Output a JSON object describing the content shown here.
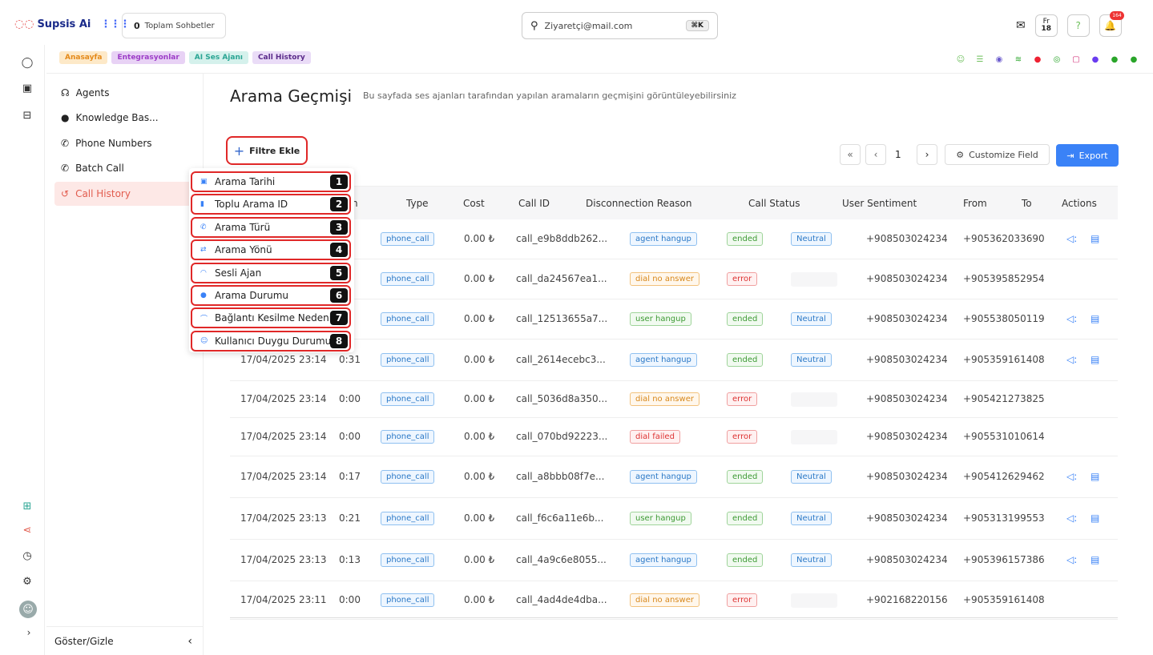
{
  "header": {
    "brand": "Supsis Ai",
    "chat_count": "0",
    "chat_label": "Toplam Sohbetler",
    "search_value": "Ziyaretçi@mail.com",
    "search_shortcut": "⌘K",
    "font_btn_top": "Fr",
    "font_btn_size": "18",
    "help": "?",
    "notif_count": "164"
  },
  "tabs": [
    {
      "label": "Anasayfa",
      "bg": "#fde9c8",
      "color": "#e48a1a"
    },
    {
      "label": "Entegrasyonlar",
      "bg": "#e8d2f5",
      "color": "#9c3cc7"
    },
    {
      "label": "AI Ses Ajanı",
      "bg": "#d5f1ec",
      "color": "#2aa593"
    },
    {
      "label": "Call History",
      "bg": "#eadcf7",
      "color": "#5a2a8a"
    }
  ],
  "sidebar": {
    "items": [
      {
        "label": "Agents"
      },
      {
        "label": "Knowledge Bas..."
      },
      {
        "label": "Phone Numbers"
      },
      {
        "label": "Batch Call"
      },
      {
        "label": "Call History"
      }
    ],
    "footer": "Göster/Gizle"
  },
  "page": {
    "title": "Arama Geçmişi",
    "subtitle": "Bu sayfada ses ajanları tarafından yapılan aramaların geçmişini görüntüleyebilirsiniz",
    "filter_btn": "Filtre Ekle",
    "page_num": "1",
    "customize": "Customize Field",
    "export": "Export"
  },
  "table": {
    "headers": [
      "n",
      "Type",
      "Cost",
      "Call ID",
      "Disconnection Reason",
      "Call Status",
      "User Sentiment",
      "From",
      "To",
      "Actions"
    ],
    "rows": [
      {
        "date": "",
        "dur": "19",
        "type": "phone_call",
        "cost": "0.00 ₺",
        "id": "call_e9b8ddb262...",
        "reason": "agent hangup",
        "rclass": "agent",
        "status": "ended",
        "sentiment": "Neutral",
        "from": "+908503024234",
        "to": "+905362033690",
        "actions": true
      },
      {
        "date": "",
        "dur": "00",
        "type": "phone_call",
        "cost": "0.00 ₺",
        "id": "call_da24567ea1...",
        "reason": "dial no answer",
        "rclass": "dna",
        "status": "error",
        "sentiment": "",
        "from": "+908503024234",
        "to": "+905395852954",
        "actions": false
      },
      {
        "date": "",
        "dur": "9",
        "type": "phone_call",
        "cost": "0.00 ₺",
        "id": "call_12513655a7...",
        "reason": "user hangup",
        "rclass": "user",
        "status": "ended",
        "sentiment": "Neutral",
        "from": "+908503024234",
        "to": "+905538050119",
        "actions": true
      },
      {
        "date": "17/04/2025 23:14",
        "dur": "0:31",
        "type": "phone_call",
        "cost": "0.00 ₺",
        "id": "call_2614ecebc3...",
        "reason": "agent hangup",
        "rclass": "agent",
        "status": "ended",
        "sentiment": "Neutral",
        "from": "+908503024234",
        "to": "+905359161408",
        "actions": true
      },
      {
        "date": "17/04/2025 23:14",
        "dur": "0:00",
        "type": "phone_call",
        "cost": "0.00 ₺",
        "id": "call_5036d8a350...",
        "reason": "dial no answer",
        "rclass": "dna",
        "status": "error",
        "sentiment": "",
        "from": "+908503024234",
        "to": "+905421273825",
        "actions": false
      },
      {
        "date": "17/04/2025 23:14",
        "dur": "0:00",
        "type": "phone_call",
        "cost": "0.00 ₺",
        "id": "call_070bd92223...",
        "reason": "dial failed",
        "rclass": "df",
        "status": "error",
        "sentiment": "",
        "from": "+908503024234",
        "to": "+905531010614",
        "actions": false
      },
      {
        "date": "17/04/2025 23:14",
        "dur": "0:17",
        "type": "phone_call",
        "cost": "0.00 ₺",
        "id": "call_a8bbb08f7e...",
        "reason": "agent hangup",
        "rclass": "agent",
        "status": "ended",
        "sentiment": "Neutral",
        "from": "+908503024234",
        "to": "+905412629462",
        "actions": true
      },
      {
        "date": "17/04/2025 23:13",
        "dur": "0:21",
        "type": "phone_call",
        "cost": "0.00 ₺",
        "id": "call_f6c6a11e6b...",
        "reason": "user hangup",
        "rclass": "user",
        "status": "ended",
        "sentiment": "Neutral",
        "from": "+908503024234",
        "to": "+905313199553",
        "actions": true
      },
      {
        "date": "17/04/2025 23:13",
        "dur": "0:13",
        "type": "phone_call",
        "cost": "0.00 ₺",
        "id": "call_4a9c6e8055...",
        "reason": "agent hangup",
        "rclass": "agent",
        "status": "ended",
        "sentiment": "Neutral",
        "from": "+908503024234",
        "to": "+905396157386",
        "actions": true
      },
      {
        "date": "17/04/2025 23:11",
        "dur": "0:00",
        "type": "phone_call",
        "cost": "0.00 ₺",
        "id": "call_4ad4de4dba...",
        "reason": "dial no answer",
        "rclass": "dna",
        "status": "error",
        "sentiment": "",
        "from": "+902168220156",
        "to": "+905359161408",
        "actions": false
      }
    ]
  },
  "dropdown": [
    {
      "label": "Arama Tarihi",
      "num": "1",
      "icon": "calendar-icon"
    },
    {
      "label": "Toplu Arama ID",
      "num": "2",
      "icon": "lock-icon"
    },
    {
      "label": "Arama Türü",
      "num": "3",
      "icon": "phone-icon"
    },
    {
      "label": "Arama Yönü",
      "num": "4",
      "icon": "direction-icon"
    },
    {
      "label": "Sesli Ajan",
      "num": "5",
      "icon": "headset-icon"
    },
    {
      "label": "Arama Durumu",
      "num": "6",
      "icon": "info-icon"
    },
    {
      "label": "Bağlantı Kesilme Nedeni",
      "num": "7",
      "icon": "hangup-icon"
    },
    {
      "label": "Kullanıcı Duygu Durumu",
      "num": "8",
      "icon": "smile-icon"
    }
  ]
}
